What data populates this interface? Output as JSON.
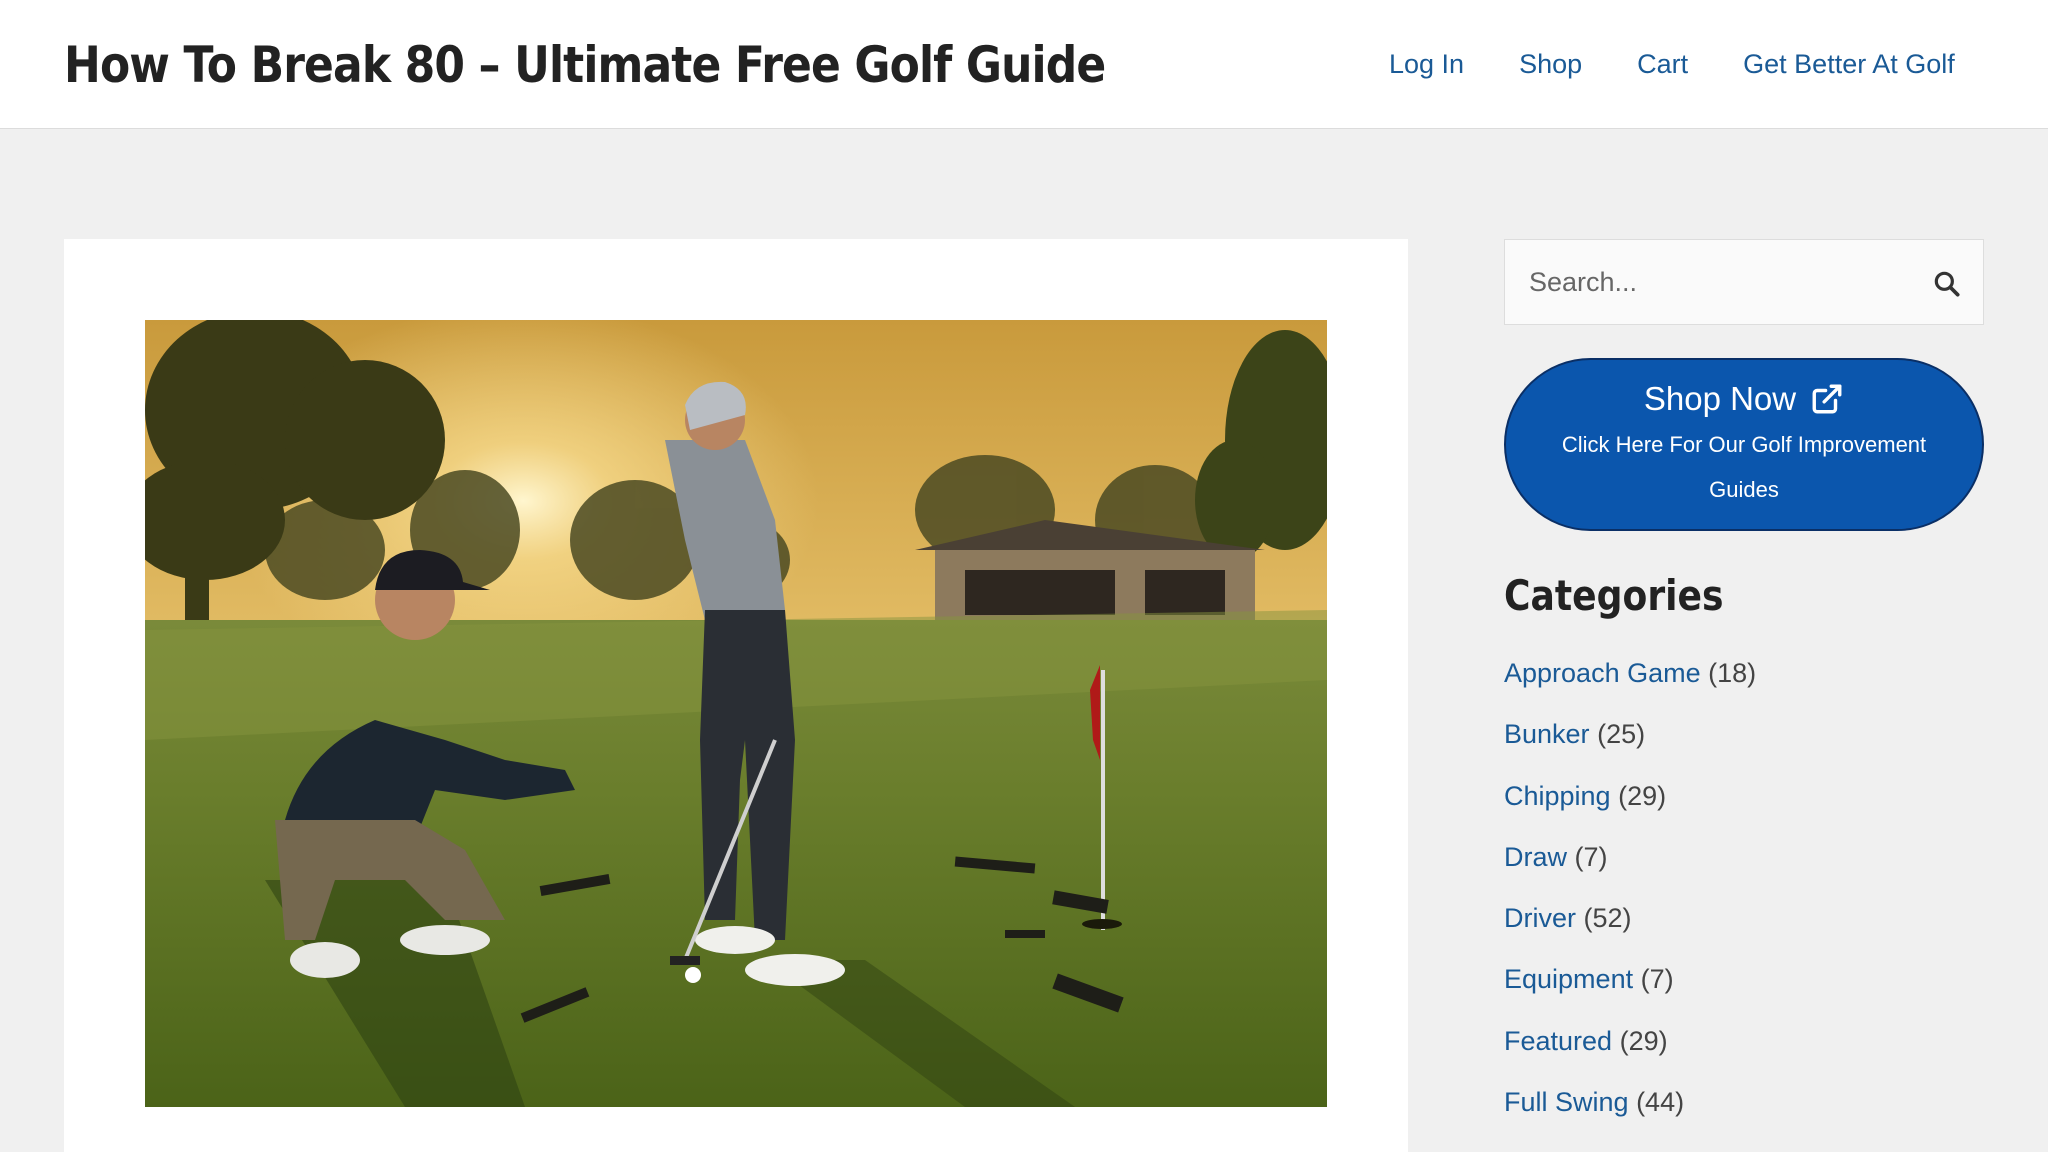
{
  "header": {
    "site_title": "How To Break 80 – Ultimate Free Golf Guide",
    "nav": [
      {
        "label": "Log In"
      },
      {
        "label": "Shop"
      },
      {
        "label": "Cart"
      },
      {
        "label": "Get Better At Golf"
      }
    ]
  },
  "colors": {
    "link": "#1a5a96",
    "button_bg": "#0b56ad",
    "page_bg": "#f0f0f0"
  },
  "sidebar": {
    "search": {
      "placeholder": "Search...",
      "icon": "search-icon"
    },
    "shop_button": {
      "title": "Shop Now",
      "subtitle": "Click Here For Our Golf Improvement Guides",
      "icon": "external-link-icon"
    },
    "categories": {
      "heading": "Categories",
      "items": [
        {
          "name": "Approach Game",
          "count": "(18)"
        },
        {
          "name": "Bunker",
          "count": "(25)"
        },
        {
          "name": "Chipping",
          "count": "(29)"
        },
        {
          "name": "Draw",
          "count": "(7)"
        },
        {
          "name": "Driver",
          "count": "(52)"
        },
        {
          "name": "Equipment",
          "count": "(7)"
        },
        {
          "name": "Featured",
          "count": "(29)"
        },
        {
          "name": "Full Swing",
          "count": "(44)"
        }
      ]
    }
  }
}
